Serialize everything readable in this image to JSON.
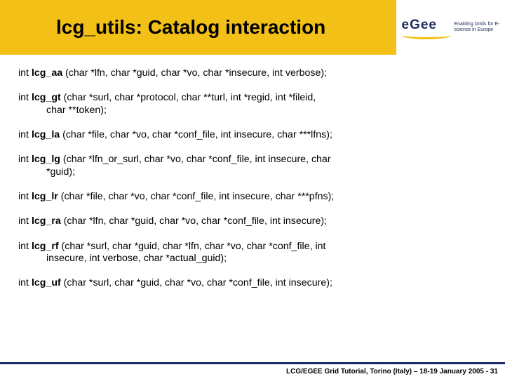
{
  "header": {
    "title": "lcg_utils: Catalog interaction",
    "logo_text": "eGee",
    "logo_tagline": "Enabling Grids for E-science in Europe"
  },
  "functions": [
    {
      "name": "lcg_aa",
      "sig_line1": " (char *lfn, char *guid, char *vo, char *insecure, int verbose);",
      "sig_line2": ""
    },
    {
      "name": "lcg_gt",
      "sig_line1": " (char *surl, char *protocol, char **turl, int *regid, int *fileid,",
      "sig_line2": "char **token);"
    },
    {
      "name": "lcg_la",
      "sig_line1": " (char *file, char *vo, char *conf_file, int insecure, char ***lfns);",
      "sig_line2": ""
    },
    {
      "name": "lcg_lg",
      "sig_line1": " (char *lfn_or_surl, char *vo, char *conf_file, int insecure, char",
      "sig_line2": "*guid);"
    },
    {
      "name": "lcg_lr",
      "sig_line1": " (char *file, char *vo, char *conf_file, int insecure, char ***pfns);",
      "sig_line2": ""
    },
    {
      "name": "lcg_ra",
      "sig_line1": " (char *lfn, char *guid, char *vo, char *conf_file, int insecure);",
      "sig_line2": ""
    },
    {
      "name": "lcg_rf",
      "sig_line1": " (char *surl, char *guid, char *lfn, char *vo, char *conf_file, int",
      "sig_line2": "insecure, int verbose, char *actual_guid);"
    },
    {
      "name": "lcg_uf",
      "sig_line1": " (char *surl, char *guid, char *vo, char *conf_file, int insecure);",
      "sig_line2": ""
    }
  ],
  "footer": {
    "text": "LCG/EGEE Grid Tutorial, Torino (Italy) – 18-19 January 2005 - 31"
  },
  "prefix": "int "
}
